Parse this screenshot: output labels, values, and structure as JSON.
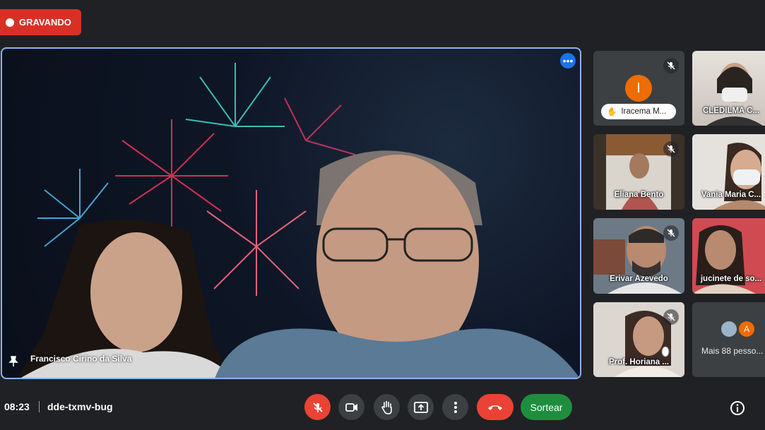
{
  "recording": {
    "label": "GRAVANDO"
  },
  "main_video": {
    "name": "Francisco Cirino da Silva"
  },
  "tiles": [
    {
      "name": "Iracema M..."
    },
    {
      "name": "CLEDILMA C..."
    },
    {
      "name": "Eliana Bento"
    },
    {
      "name": "Vania Maria C..."
    },
    {
      "name": "Erivar Azevedo"
    },
    {
      "name": "jucinete de so..."
    },
    {
      "name": "Prof. Horiana ..."
    },
    {
      "name": "Mais 88 pesso..."
    }
  ],
  "avatar_letter": "I",
  "more_avatar_letter": "A",
  "meeting": {
    "time": "08:23",
    "code": "dde-txmv-bug"
  },
  "controls": {
    "sortear_label": "Sortear"
  },
  "colors": {
    "accent": "#8ab4f8",
    "danger": "#ea4335",
    "success": "#1e8e3e",
    "background": "#202124"
  }
}
